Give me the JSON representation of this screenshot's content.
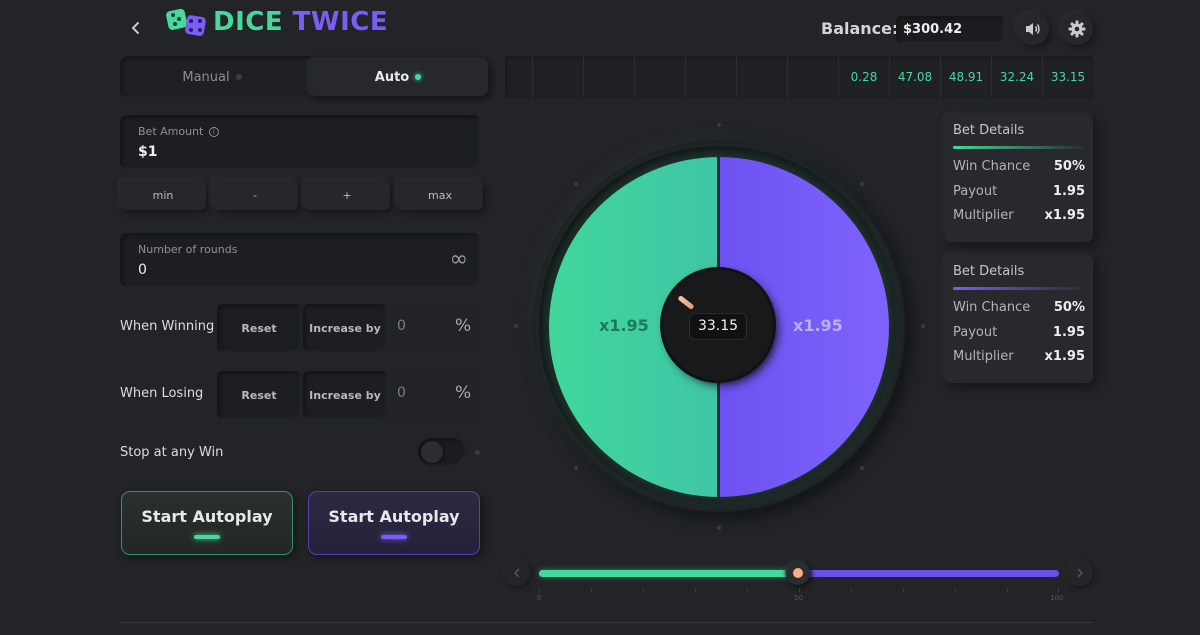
{
  "header": {
    "back_icon": "chevron-left-icon",
    "logo_icon": "dice-icon",
    "title_part1": "DICE",
    "title_part2": "TWICE",
    "balance_label": "Balance:",
    "balance_value": "$300.42",
    "sound_icon": "speaker-icon",
    "settings_icon": "gear-icon"
  },
  "mode_tabs": [
    {
      "label": "Manual",
      "active": false
    },
    {
      "label": "Auto",
      "active": true
    }
  ],
  "bet_amount": {
    "label": "Bet Amount",
    "value": "$1"
  },
  "quick_buttons": [
    "min",
    "-",
    "+",
    "max"
  ],
  "rounds": {
    "label": "Number of rounds",
    "value": "0",
    "infinity": "∞"
  },
  "when_winning": {
    "label": "When Winning",
    "reset": "Reset",
    "increase": "Increase by",
    "value": "0",
    "unit": "%"
  },
  "when_losing": {
    "label": "When Losing",
    "reset": "Reset",
    "increase": "Increase by",
    "value": "0",
    "unit": "%"
  },
  "stop_at_win": {
    "label": "Stop at any Win",
    "enabled": false
  },
  "autoplay_buttons": [
    {
      "label": "Start Autoplay",
      "color": "#45d99a"
    },
    {
      "label": "Start Autoplay",
      "color": "#7b5cf5"
    }
  ],
  "history": [
    "0.28",
    "47.08",
    "48.91",
    "32.24",
    "33.15"
  ],
  "wheel": {
    "left_multiplier": "x1.95",
    "right_multiplier": "x1.95",
    "result": "33.15",
    "green": "#45d99a",
    "purple": "#7b5cf5"
  },
  "bet_details": [
    {
      "title": "Bet Details",
      "win_chance_label": "Win Chance",
      "win_chance": "50%",
      "payout_label": "Payout",
      "payout": "1.95",
      "multiplier_label": "Multiplier",
      "multiplier": "x1.95"
    },
    {
      "title": "Bet Details",
      "win_chance_label": "Win Chance",
      "win_chance": "50%",
      "payout_label": "Payout",
      "payout": "1.95",
      "multiplier_label": "Multiplier",
      "multiplier": "x1.95"
    }
  ],
  "slider": {
    "value": 50,
    "min_label": "0",
    "mid_label": "50",
    "max_label": "100"
  }
}
